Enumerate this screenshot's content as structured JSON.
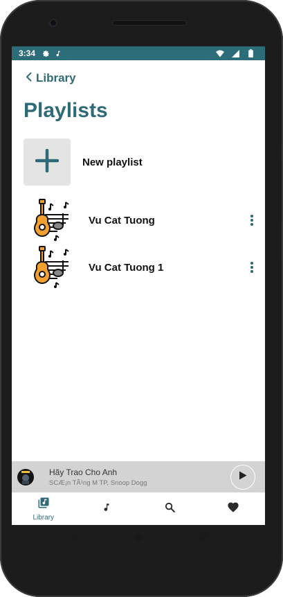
{
  "status_bar": {
    "time": "3:34",
    "background": "#2d6c79",
    "left_icons": [
      "settings-icon",
      "music-note-icon"
    ],
    "right_icons": [
      "wifi-icon",
      "signal-icon",
      "battery-icon"
    ]
  },
  "header": {
    "back_label": "Library",
    "title": "Playlists"
  },
  "new_playlist": {
    "label": "New playlist",
    "icon": "plus-icon"
  },
  "playlists": [
    {
      "name": "Vu Cat Tuong",
      "thumb_icon": "guitar-music-icon",
      "menu_icon": "more-vertical-icon"
    },
    {
      "name": "Vu Cat Tuong 1",
      "thumb_icon": "guitar-music-icon",
      "menu_icon": "more-vertical-icon"
    }
  ],
  "mini_player": {
    "song": "Hãy Trao Cho Anh",
    "artist": "SCÆ¡n TÃ¹ng M TP, Snoop Dogg",
    "play_icon": "play-icon"
  },
  "bottom_nav": {
    "items": [
      {
        "label": "Library",
        "icon": "library-music-icon",
        "active": true
      },
      {
        "label": "",
        "icon": "music-note-icon",
        "active": false
      },
      {
        "label": "",
        "icon": "search-icon",
        "active": false
      },
      {
        "label": "",
        "icon": "heart-icon",
        "active": false
      }
    ]
  },
  "colors": {
    "accent": "#2f6a78",
    "mini_player_bg": "#d3d3d3",
    "tile_bg": "#e4e4e4",
    "guitar": "#f0a030"
  }
}
